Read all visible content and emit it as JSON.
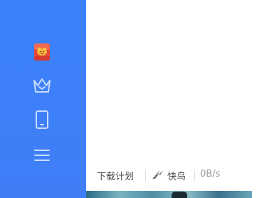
{
  "sidebar": {
    "accent_color": "#3d80f9",
    "items": [
      {
        "name": "red-packet",
        "icon": "red-envelope-icon"
      },
      {
        "name": "vip",
        "icon": "crown-icon"
      },
      {
        "name": "mobile",
        "icon": "phone-icon"
      },
      {
        "name": "menu",
        "icon": "menu-icon"
      }
    ]
  },
  "statusbar": {
    "download_plan_label": "下载计划",
    "kuainiao_label": "快鸟",
    "kuainiao_icon": "bird-icon",
    "speed": "0B/s"
  }
}
